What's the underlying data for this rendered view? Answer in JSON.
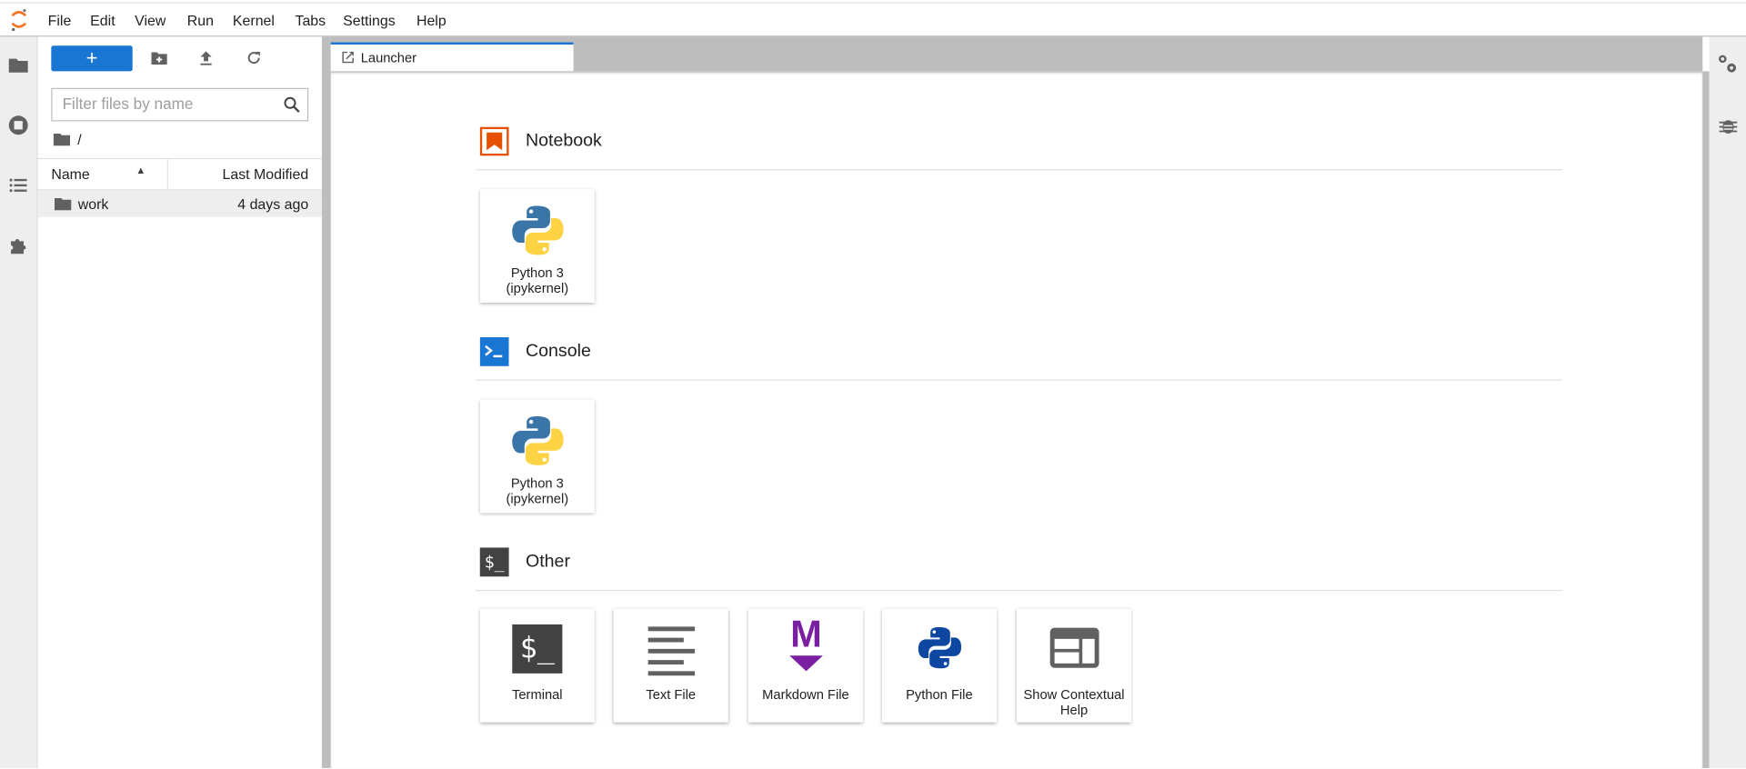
{
  "menubar": {
    "items": [
      "File",
      "Edit",
      "View",
      "Run",
      "Kernel",
      "Tabs",
      "Settings",
      "Help"
    ]
  },
  "filebrowser": {
    "new_label": "+",
    "filter_placeholder": "Filter files by name",
    "breadcrumb": "/",
    "columns": {
      "name": "Name",
      "modified": "Last Modified"
    },
    "rows": [
      {
        "name": "work",
        "modified": "4 days ago"
      }
    ]
  },
  "tabs": [
    {
      "label": "Launcher"
    }
  ],
  "launcher": {
    "notebook": {
      "title": "Notebook",
      "cards": [
        {
          "label": "Python 3 (ipykernel)"
        }
      ]
    },
    "console": {
      "title": "Console",
      "cards": [
        {
          "label": "Python 3 (ipykernel)"
        }
      ]
    },
    "other": {
      "title": "Other",
      "cards": [
        {
          "label": "Terminal"
        },
        {
          "label": "Text File"
        },
        {
          "label": "Markdown File"
        },
        {
          "label": "Python File"
        },
        {
          "label": "Show Contextual Help"
        }
      ],
      "terminal_glyph": "$_",
      "markdown_glyph": "M"
    }
  },
  "colors": {
    "accent": "#1976d2",
    "notebook": "#e65100",
    "console": "#1976d2",
    "markdown": "#7b1fa2",
    "pyblue": "#0d47a1"
  }
}
